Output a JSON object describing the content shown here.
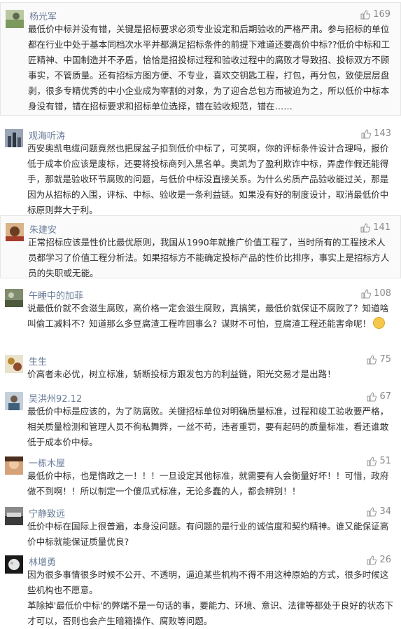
{
  "comments": [
    {
      "name": "杨光军",
      "likes": "169",
      "text": "最低价中标并没有错，关键是招标要求必须专业设定和后期验收的严格严肃。参与招标的单位都在行业中处于基本同档次水平并都满足招标条件的前提下难道还要高价中标??低价中标和工匠精神、中国制造并不矛盾，恰恰是招投标过程和验收过程中的腐败才导致招、投标双方不顾事实，不管质量。还有招标方图方便、不专业，喜欢交钥匙工程，打包，再分包，致使层层盘剥，很多专精优秀的中小企业成为宰割的对象，为了迎合总包方而被迫为之，所以低价中标本身没有错，错在招标要求和招标单位选择，错在验收规范，错在……"
    },
    {
      "name": "观海听涛",
      "likes": "143",
      "text": "西安奥凯电缆问题竟然也把屎盆子扣到低价中标了，可笑啊，你的评标条件设计合理吗，报价低于成本价应该是废标，还要将投标商列入黑名单。奥凯为了盈利欺诈中标，弄虚作假还能得手，那就是验收环节腐败的问题，与低价中标没直接关系。为什么劣质产品验收能过关，那是因为从招标的入围，评标、中标、验收是一条利益链。如果没有好的制度设计，取消最低价中标原则弊大于利。"
    },
    {
      "name": "朱建安",
      "likes": "141",
      "text": "正常招标应该是性价比最优原则，我国从1990年就推广价值工程了，当时所有的工程技术人员都学习了价值工程分析法。如果招标方不能确定投标产品的性价比排序，事实上是招标方人员的失职或无能。"
    },
    {
      "name": "午睡中的加菲",
      "likes": "108",
      "text": "说最低价就不会滋生腐败，高价格一定会滋生腐败，真搞笑，最低价就保证不腐败了？知道啥叫偷工减料不？知道那么多豆腐渣工程咋回事么？谋财不可怕，豆腐渣工程还能害命呢！"
    },
    {
      "name": "生生",
      "likes": "75",
      "text": "价高者未必优，树立标准，斩断投标方跟发包方的利益链，阳光交易才是出路！"
    },
    {
      "name": "吴洪州92.12",
      "likes": "67",
      "text": "最低价中标是应该的，为了防腐败。关键招标单位对明确质量标准，过程和竣工验收要严格，相关质量检测和管理人员不徇私舞弊，一丝不苟，违者重罚，要有起码的质量标准，看还谁敢低于成本价中标。"
    },
    {
      "name": "一栋木屋",
      "likes": "51",
      "text": "最低价中标，也是惰政之一！！！一旦设定其他标准，就需要有人会衡量好坏！！可惜，政府做不到啊！！所以制定一个傻瓜式标准，无论多蠢的人，都会辨别！！"
    },
    {
      "name": "宁静致远",
      "likes": "34",
      "text": "低价中标在国际上很普遍，本身没问题。有问题的是行业的诚信度和契约精神。谁又能保证高价中标就能保证质量优良?"
    },
    {
      "name": "林增勇",
      "likes": "26",
      "text": "因为很多事情很多时候不公开、不透明，逼迫某些机构不得不用这种原始的方式，很多时候这些机构也不愿意。",
      "text2": "革除掉'最低价中标'的弊端不是一句话的事，要能力、环境、意识、法律等都处于良好的状态下才可以，否则也会产生暗箱操作、腐败等问题。"
    }
  ]
}
